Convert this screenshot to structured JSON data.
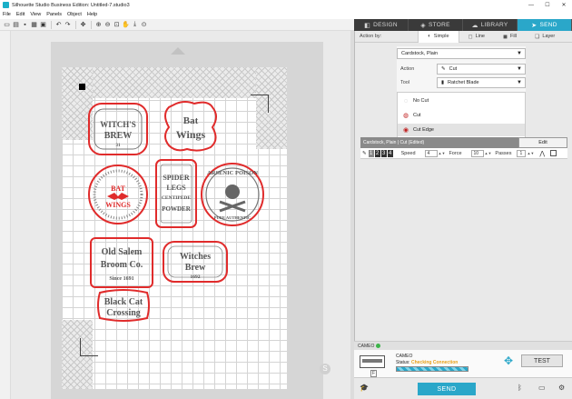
{
  "window": {
    "title": "Silhouette Studio Business Edition: Untitled-7.studio3",
    "controls": [
      "—",
      "☐",
      "✕"
    ]
  },
  "menu": [
    "File",
    "Edit",
    "View",
    "Panels",
    "Object",
    "Help"
  ],
  "nav_tabs": [
    {
      "label": "DESIGN",
      "icon": "design-icon",
      "active": false
    },
    {
      "label": "STORE",
      "icon": "store-icon",
      "active": false
    },
    {
      "label": "LIBRARY",
      "icon": "library-icon",
      "active": false
    },
    {
      "label": "SEND",
      "icon": "send-icon",
      "active": true
    }
  ],
  "action_by": {
    "label": "Action by:",
    "tabs": [
      {
        "label": "Simple",
        "active": true
      },
      {
        "label": "Line",
        "active": false
      },
      {
        "label": "Fill",
        "active": false
      },
      {
        "label": "Layer",
        "active": false
      }
    ]
  },
  "material": {
    "selected": "Cardstock, Plain",
    "action_label": "Action",
    "action_value": "Cut",
    "tool_label": "Tool",
    "tool_value": "Ratchet Blade"
  },
  "cut_options": [
    {
      "label": "No Cut",
      "selected": false
    },
    {
      "label": "Cut",
      "selected": false
    },
    {
      "label": "Cut Edge",
      "selected": true
    }
  ],
  "cut_bar": {
    "text": "Cardstock, Plain | Cut (Edited)",
    "edit_label": "Edit"
  },
  "settings": {
    "blade_steps": [
      "1",
      "2",
      "3",
      "4"
    ],
    "speed_label": "Speed",
    "speed": "4",
    "force_label": "Force",
    "force": "10",
    "passes_label": "Passes",
    "passes": "1"
  },
  "device": {
    "header": "CAMEO",
    "name": "CAMEO",
    "status_label": "Status:",
    "status_value": "Checking Connection",
    "test_label": "TEST"
  },
  "footer": {
    "send_label": "SEND"
  },
  "canvas": {
    "watermark_icon": "silhouette-logo-icon"
  },
  "labels_art": {
    "witchs_brew": [
      "WITCH'S",
      "BREW"
    ],
    "bat_wings": [
      "Bat",
      "Wings"
    ],
    "bat_wings_small": [
      "BAT",
      "WINGS"
    ],
    "spider": [
      "SPIDER",
      "LEGS",
      "CENTIPEDE",
      "POWDER"
    ],
    "arsenic": "ARSENIC POISON",
    "arsenic_small": "PURE AUTHENTIC",
    "old_salem": [
      "Old Salem",
      "Broom Co.",
      "Since 1691"
    ],
    "witches_brew": [
      "Witches",
      "Brew",
      "1692"
    ],
    "black_cat": [
      "Black Cat",
      "Crossing"
    ],
    "witchs_num": "31"
  },
  "colors": {
    "accent": "#2aa7c9",
    "cut_line": "#e02b2b",
    "status_warn": "#e8a11a"
  }
}
